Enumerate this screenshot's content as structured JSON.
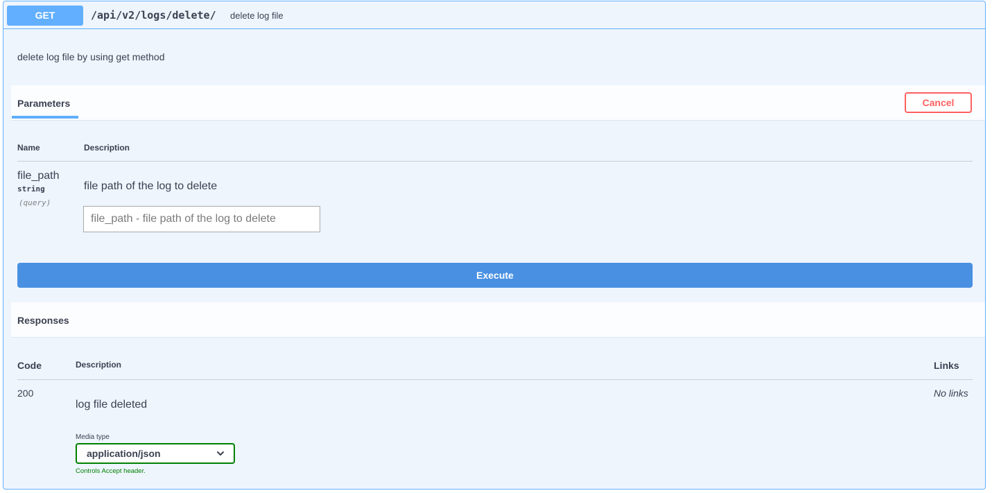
{
  "operation": {
    "method": "GET",
    "path": "/api/v2/logs/delete/",
    "summary": "delete log file",
    "description": "delete log file by using get method"
  },
  "parameters": {
    "tab_label": "Parameters",
    "cancel_label": "Cancel",
    "columns": {
      "name": "Name",
      "description": "Description"
    },
    "items": [
      {
        "name": "file_path",
        "type": "string",
        "in": "(query)",
        "description": "file path of the log to delete",
        "input_value": "",
        "placeholder": "file_path - file path of the log to delete"
      }
    ],
    "execute_label": "Execute"
  },
  "responses": {
    "title": "Responses",
    "columns": {
      "code": "Code",
      "description": "Description",
      "links": "Links"
    },
    "items": [
      {
        "code": "200",
        "description": "log file deleted",
        "links": "No links",
        "media_type_label": "Media type",
        "media_type_value": "application/json",
        "media_type_hint": "Controls Accept header."
      }
    ]
  },
  "colors": {
    "method_get": "#61affe",
    "execute": "#4990e2",
    "cancel": "#ff6060",
    "media_select_border": "#008000"
  },
  "icons": {
    "media_select": "chevron-down-icon"
  }
}
